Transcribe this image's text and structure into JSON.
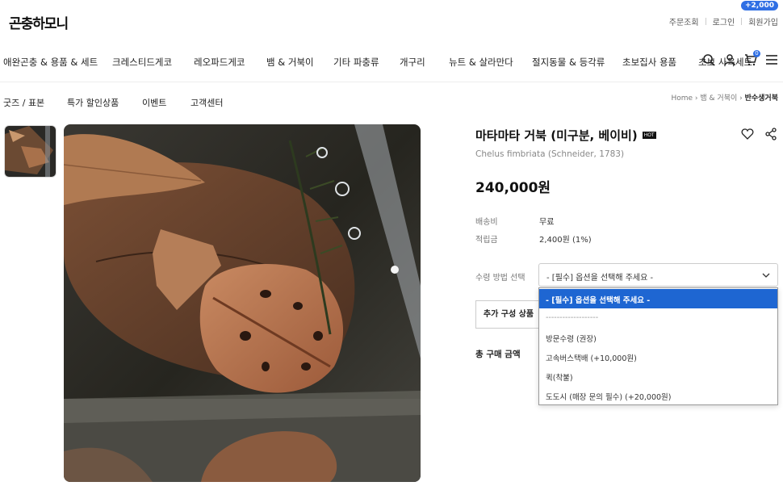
{
  "header": {
    "logo": "곤충하모니",
    "top_links": [
      "주문조회",
      "로그인",
      "회원가입"
    ],
    "signup_badge": "+2,000",
    "cart_count": "0"
  },
  "nav": {
    "categories": [
      "애완곤충 & 용품 & 세트",
      "크레스티드게코",
      "레오파드게코",
      "뱀 & 거북이",
      "기타 파충류",
      "개구리",
      "뉴트 & 살라만다",
      "절지동물 & 등각류",
      "초보집사 용품",
      "초보 사육세트"
    ],
    "sub": [
      "굿즈 / 표본",
      "특가 할인상품",
      "이벤트",
      "고객센터"
    ]
  },
  "breadcrumb": {
    "items": [
      "Home",
      "뱀 & 거북이"
    ],
    "current": "반수생거북"
  },
  "product": {
    "title": "마타마타 거북 (미구분, 베이비)",
    "tag": "HOT",
    "scientific_name": "Chelus fimbriata (Schneider, 1783)",
    "price": "240,000원",
    "shipping_label": "배송비",
    "shipping_value": "무료",
    "points_label": "적립금",
    "points_value": "2,400원 (1%)",
    "option_label": "수령 방법 선택",
    "option_selected": "- [필수] 옵션을 선택해 주세요 -",
    "extra_button": "추가 구성 상품",
    "total_label": "총 구매 금액"
  },
  "dropdown": {
    "options": [
      "- [필수] 옵션을 선택해 주세요 -",
      "-------------------",
      "방문수령 (권장)",
      "고속버스택배 (+10,000원)",
      "퀵(착불)",
      "도도시 (매장 문의 필수) (+20,000원)"
    ]
  }
}
